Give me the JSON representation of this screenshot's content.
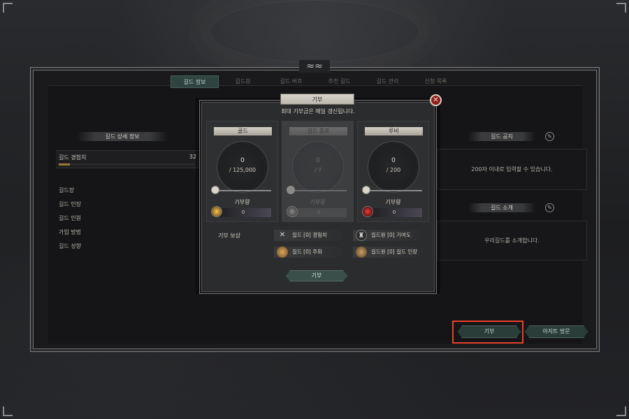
{
  "tabs": [
    {
      "label": "길드 정보",
      "active": true
    },
    {
      "label": "길드원"
    },
    {
      "label": "길드 버프"
    },
    {
      "label": "추천 길드"
    },
    {
      "label": "길드 관리"
    },
    {
      "label": "신청 목록"
    }
  ],
  "left_panel": {
    "section_title": "길드 상세 정보",
    "exp_label": "길드 경험치",
    "exp_value": "32",
    "info_items": [
      "길드장",
      "길드 인장",
      "길드 인원",
      "가입 방법",
      "길드 성향"
    ]
  },
  "right_panel": {
    "notice_title": "길드 공지",
    "notice_placeholder": "200자 이내로 입력할 수 있습니다.",
    "intro_title": "길드 소개",
    "intro_text": "우리길드를 소개합니다."
  },
  "bottom_buttons": {
    "donate": "기부",
    "hideout": "아지트 방문"
  },
  "modal": {
    "title": "기부",
    "close_icon": "close-icon",
    "subtitle": "최대 기부금은 매일 갱신됩니다.",
    "cards": [
      {
        "name": "골드",
        "current": "0",
        "max": "/ 125,000",
        "label": "기부량",
        "amount": "0",
        "icon": "gold-coin-icon",
        "enabled": true
      },
      {
        "name": "길드 증표",
        "current": "0",
        "max": "/ ?",
        "label": "기부량",
        "amount": "0",
        "icon": "guild-token-icon",
        "enabled": false
      },
      {
        "name": "루비",
        "current": "0",
        "max": "/ 200",
        "label": "기부량",
        "amount": "0",
        "icon": "ruby-icon",
        "enabled": true
      }
    ],
    "reward_title": "기부 보상",
    "rewards": [
      {
        "text": "길드 [0] 경험치",
        "icon": "crossed-swords-icon"
      },
      {
        "text": "길드원 [0] 기여도",
        "icon": "helmet-icon"
      },
      {
        "text": "길드 [0] 주화",
        "icon": "coin-icon"
      },
      {
        "text": "길드원 [0] 길드 인장",
        "icon": "seal-icon"
      }
    ],
    "confirm_button": "기부"
  }
}
